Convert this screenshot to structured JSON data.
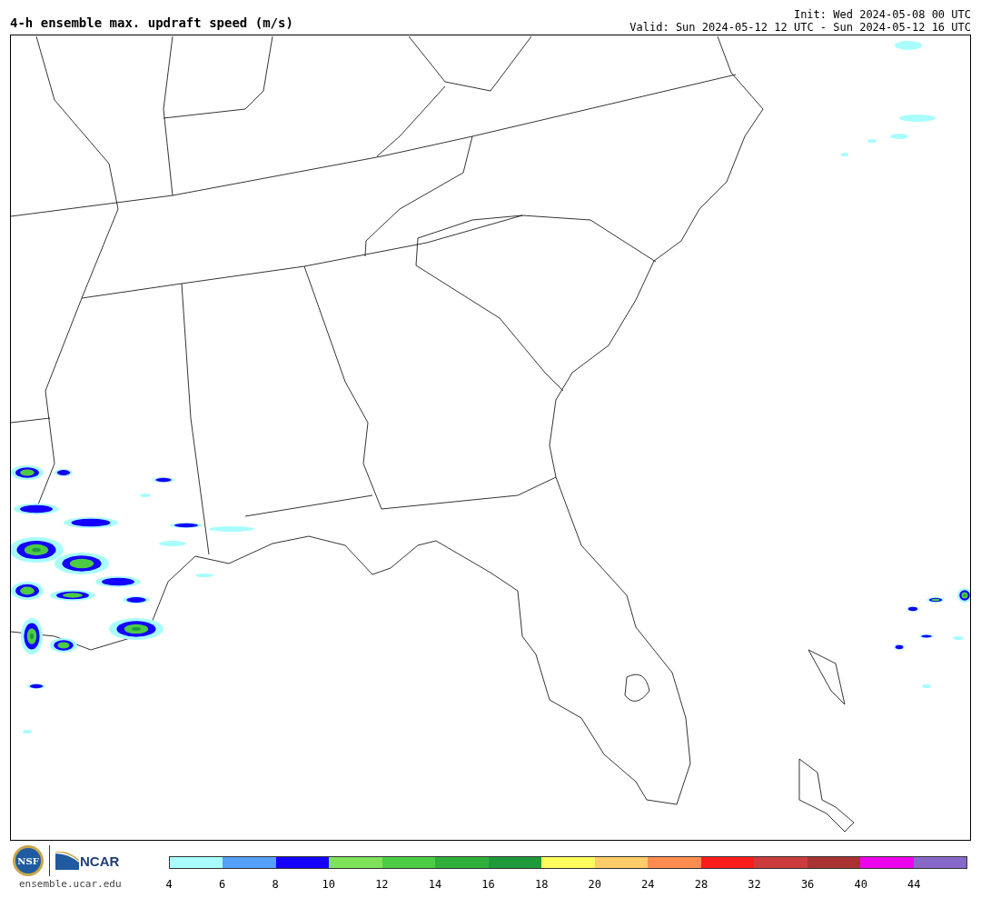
{
  "title": "4-h ensemble max. updraft speed (m/s)",
  "init": "Init: Wed 2024-05-08 00 UTC",
  "valid": "Valid: Sun 2024-05-12 12 UTC - Sun 2024-05-12 16 UTC",
  "logos": {
    "nsf": "NSF",
    "ncar": "NCAR",
    "site": "ensemble.ucar.edu"
  },
  "colorbar": [
    {
      "label": "4",
      "color": "#a8fcfc"
    },
    {
      "label": "6",
      "color": "#54a0fc"
    },
    {
      "label": "8",
      "color": "#1400fc"
    },
    {
      "label": "10",
      "color": "#7ee25a"
    },
    {
      "label": "12",
      "color": "#4ccb44"
    },
    {
      "label": "14",
      "color": "#2fb03a"
    },
    {
      "label": "16",
      "color": "#1e9a3a"
    },
    {
      "label": "18",
      "color": "#fcfc5c"
    },
    {
      "label": "20",
      "color": "#fccd68"
    },
    {
      "label": "24",
      "color": "#fc8c50"
    },
    {
      "label": "28",
      "color": "#fc1c1c"
    },
    {
      "label": "32",
      "color": "#cc3c3c"
    },
    {
      "label": "36",
      "color": "#a83232"
    },
    {
      "label": "40",
      "color": "#ec04ec"
    },
    {
      "label": "44",
      "color": "#8868c8"
    }
  ]
}
